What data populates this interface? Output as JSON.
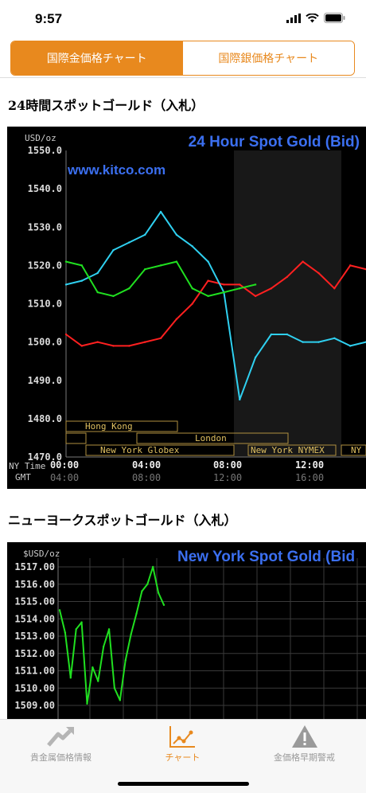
{
  "status": {
    "time": "9:57"
  },
  "segments": [
    {
      "label": "国際金価格チャート",
      "active": true
    },
    {
      "label": "国際銀価格チャート",
      "active": false
    }
  ],
  "section1": {
    "title": "24時間スポットゴールド（入札）"
  },
  "section2": {
    "title": "ニューヨークスポットゴールド（入札）"
  },
  "chart1": {
    "header": "24 Hour Spot Gold (Bid)",
    "watermark": "www.kitco.com",
    "unit": "USD/oz",
    "y_ticks": [
      "1550.0",
      "1540.0",
      "1530.0",
      "1520.0",
      "1510.0",
      "1500.0",
      "1490.0",
      "1480.0",
      "1470.0"
    ],
    "sessions": [
      "Hong Kong",
      "London",
      "New York Globex",
      "New York NYMEX",
      "NY"
    ],
    "row1_label": "NY Time",
    "row2_label": "GMT",
    "ny_ticks": [
      "00:00",
      "04:00",
      "08:00",
      "12:00"
    ],
    "gmt_ticks": [
      "04:00",
      "08:00",
      "12:00",
      "16:00"
    ]
  },
  "chart2": {
    "header": "New York Spot Gold (Bid",
    "unit": "$USD/oz",
    "y_ticks": [
      "1517.00",
      "1516.00",
      "1515.00",
      "1514.00",
      "1513.00",
      "1512.00",
      "1511.00",
      "1510.00",
      "1509.00"
    ]
  },
  "chart_data": [
    {
      "type": "line",
      "title": "24 Hour Spot Gold (Bid)",
      "ylabel": "USD/oz",
      "ylim": [
        1470,
        1550
      ],
      "x": [
        "00:00",
        "01:00",
        "02:00",
        "03:00",
        "04:00",
        "05:00",
        "06:00",
        "07:00",
        "08:00",
        "08:30",
        "09:00",
        "09:15",
        "09:30",
        "10:00",
        "11:00",
        "12:00",
        "13:00",
        "14:00",
        "15:00",
        "16:00"
      ],
      "series": [
        {
          "color": "#ff2020",
          "values": [
            1502,
            1499,
            1500,
            1499,
            1499,
            1500,
            1501,
            1506,
            1510,
            1516,
            1515,
            1515,
            1512,
            1514,
            1517,
            1521,
            1518,
            1514,
            1520,
            1519
          ]
        },
        {
          "color": "#2fd0f0",
          "values": [
            1515,
            1516,
            1518,
            1524,
            1526,
            1528,
            1534,
            1528,
            1525,
            1521,
            1513,
            1485,
            1496,
            1502,
            1502,
            1500,
            1500,
            1501,
            1499,
            1500
          ]
        },
        {
          "color": "#20e020",
          "values": [
            1521,
            1520,
            1513,
            1512,
            1514,
            1519,
            1520,
            1521,
            1514,
            1512,
            1513,
            1514,
            1515,
            null,
            null,
            null,
            null,
            null,
            null,
            null
          ]
        }
      ]
    },
    {
      "type": "line",
      "title": "New York Spot Gold (Bid",
      "ylabel": "$USD/oz",
      "ylim": [
        1508.5,
        1517.5
      ],
      "x": [
        1,
        2,
        3,
        4,
        5,
        6,
        7,
        8,
        9,
        10,
        11,
        12,
        13,
        14,
        15,
        16,
        17,
        18,
        19,
        20
      ],
      "series": [
        {
          "color": "#20e020",
          "values": [
            1514.5,
            1513.2,
            1510.6,
            1513.4,
            1513.8,
            1509.1,
            1511.2,
            1510.4,
            1512.4,
            1513.4,
            1510.0,
            1509.3,
            1511.6,
            1513.1,
            1514.3,
            1515.6,
            1516.0,
            1517.0,
            1515.5,
            1514.8
          ]
        }
      ]
    }
  ],
  "tabs": [
    {
      "label": "貴金属価格情報",
      "icon": "trend-up-icon",
      "active": false
    },
    {
      "label": "チャート",
      "icon": "chart-icon",
      "active": true
    },
    {
      "label": "金価格早期警戒",
      "icon": "warning-icon",
      "active": false
    }
  ],
  "colors": {
    "accent": "#e8891e",
    "inactive": "#9a9a9a"
  }
}
